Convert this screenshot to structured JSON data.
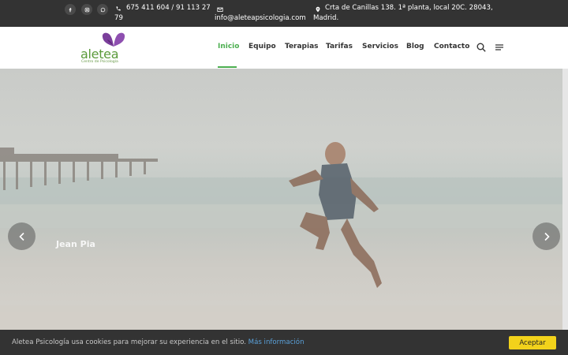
{
  "topbar": {
    "social": [
      {
        "name": "facebook-icon"
      },
      {
        "name": "instagram-icon"
      },
      {
        "name": "whatsapp-icon"
      }
    ],
    "phone": "675 411 604 / 91 113 27",
    "phone_cont": "79",
    "email": "info@aleteapsicologia.com",
    "address_line1": "Crta de Canillas 138. 1ª planta, local 20C. 28043,",
    "address_line2": "Madrid."
  },
  "header": {
    "logo_name": "aletea",
    "logo_tagline": "Centro de Psicología",
    "nav": [
      "Inicio",
      "Equipo",
      "Terapias",
      "Tarifas",
      "Servicios",
      "Blog",
      "Contacto"
    ],
    "active_nav": "Inicio"
  },
  "hero": {
    "caption": "Jean Pia"
  },
  "cookie": {
    "text": "Aletea Psicología usa cookies para mejorar su experiencia en el sitio.",
    "link": "Más información",
    "accept": "Aceptar"
  },
  "colors": {
    "accent": "#4caf50",
    "topbar_bg": "#333333",
    "logo_purple": "#7b3f9b",
    "accept_bg": "#f2d21b"
  }
}
